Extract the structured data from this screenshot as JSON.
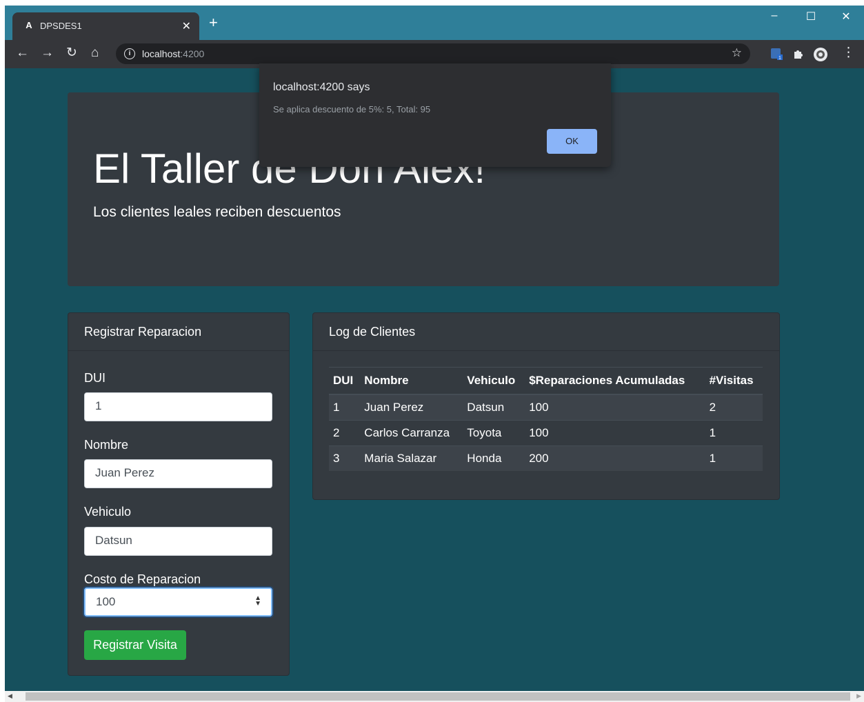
{
  "browser": {
    "tab_title": "DPSDES1",
    "tab_favicon": "A",
    "url_host": "localhost",
    "url_port": ":4200"
  },
  "jumbotron": {
    "title": "El Taller de Don Alex!",
    "subtitle": "Los clientes leales reciben descuentos"
  },
  "form": {
    "header": "Registrar Reparacion",
    "dui_label": "DUI",
    "dui_value": "1",
    "nombre_label": "Nombre",
    "nombre_value": "Juan Perez",
    "vehiculo_label": "Vehiculo",
    "vehiculo_value": "Datsun",
    "costo_label": "Costo de Reparacion",
    "costo_value": "100",
    "submit_label": "Registrar Visita"
  },
  "log": {
    "header": "Log de Clientes",
    "columns": [
      "DUI",
      "Nombre",
      "Vehiculo",
      "$Reparaciones Acumuladas",
      "#Visitas"
    ],
    "rows": [
      [
        "1",
        "Juan Perez",
        "Datsun",
        "100",
        "2"
      ],
      [
        "2",
        "Carlos Carranza",
        "Toyota",
        "100",
        "1"
      ],
      [
        "3",
        "Maria Salazar",
        "Honda",
        "200",
        "1"
      ]
    ]
  },
  "dialog": {
    "title": "localhost:4200 says",
    "message": "Se aplica descuento de 5%: 5, Total: 95",
    "ok_label": "OK"
  },
  "colors": {
    "page_bg": "#16505d",
    "card_bg": "#343a40",
    "button_green": "#28a745",
    "dialog_ok": "#8ab4f8"
  }
}
